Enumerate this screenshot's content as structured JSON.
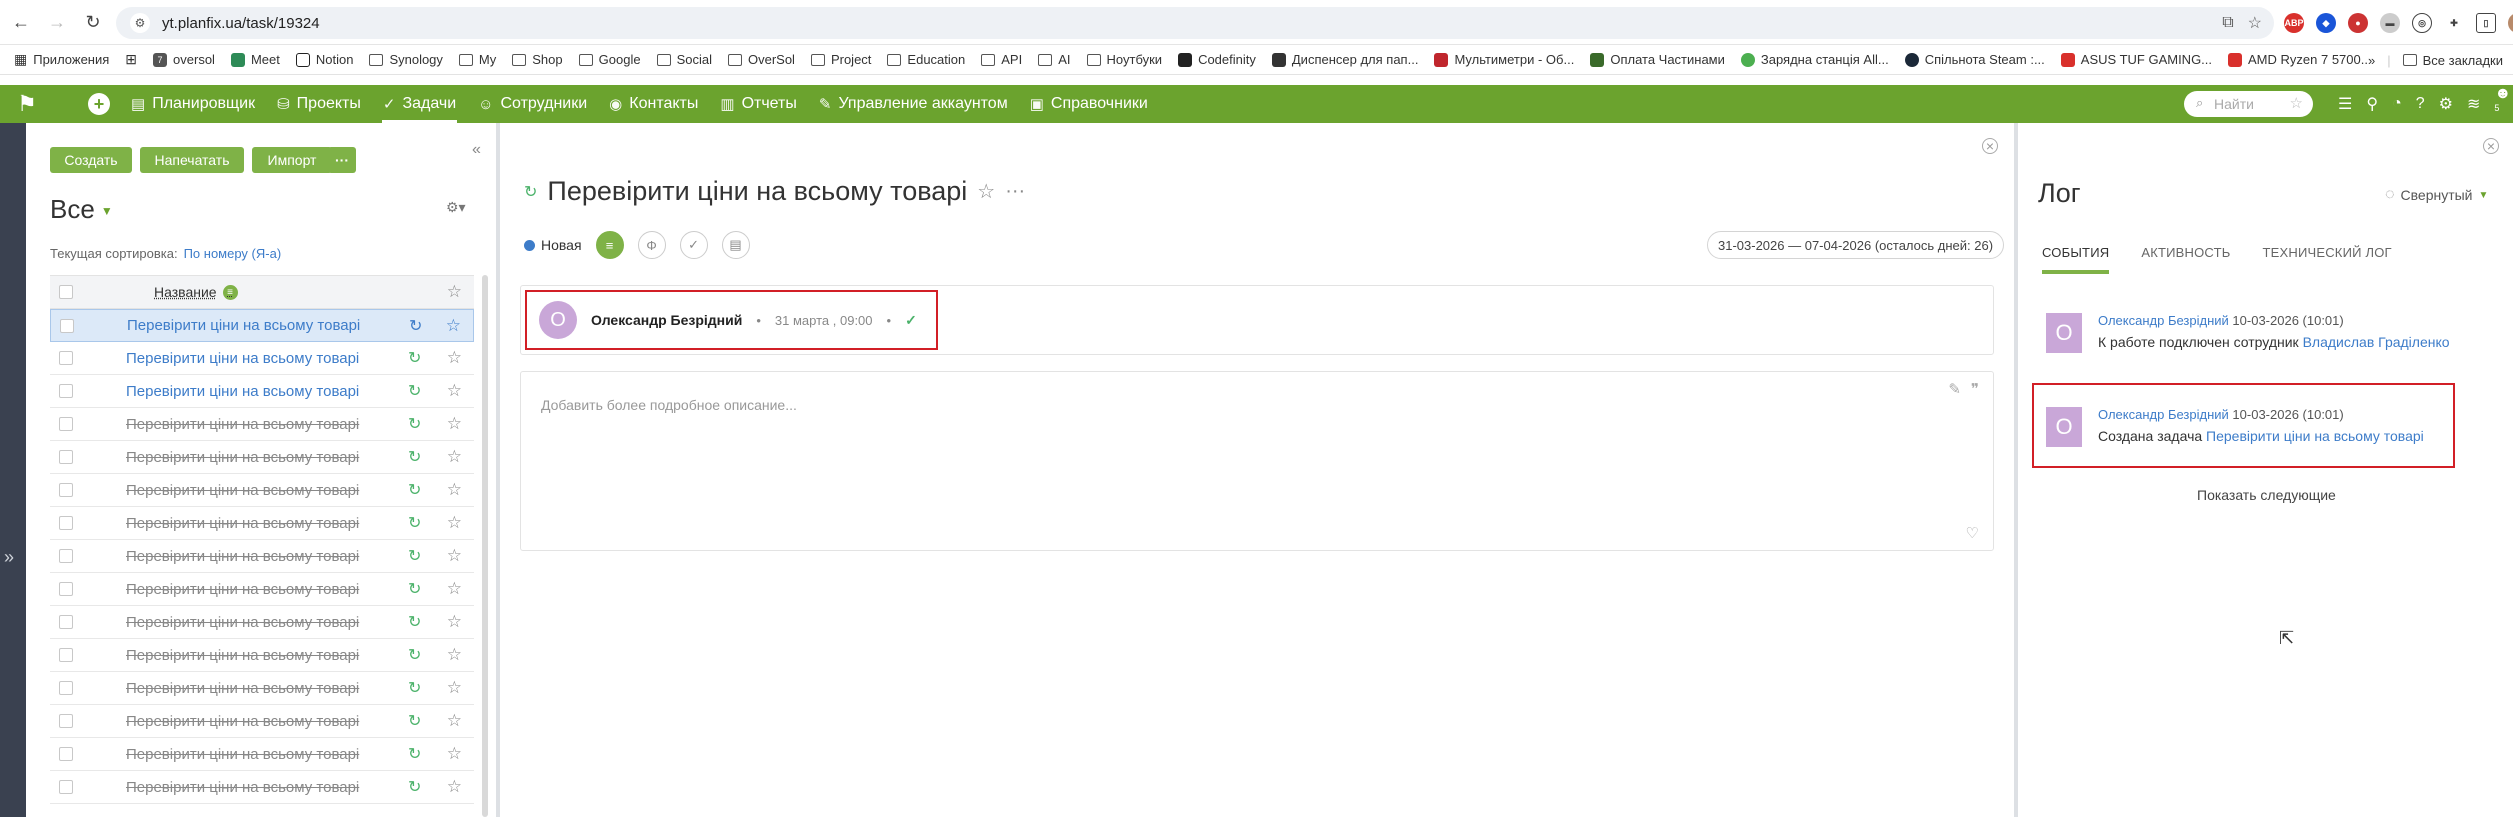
{
  "browser": {
    "url": "yt.planfix.ua/task/19324",
    "bookmarks": [
      {
        "label": "Приложения",
        "icon": "apps-grid-icon"
      },
      {
        "label": "",
        "icon": "grid-icon"
      },
      {
        "label": "oversol",
        "icon": "oversol-favicon"
      },
      {
        "label": "Meet",
        "icon": "meet-favicon"
      },
      {
        "label": "Notion",
        "icon": "notion-favicon"
      },
      {
        "label": "Synology",
        "icon": "folder-icon"
      },
      {
        "label": "My",
        "icon": "folder-icon"
      },
      {
        "label": "Shop",
        "icon": "folder-icon"
      },
      {
        "label": "Google",
        "icon": "folder-icon"
      },
      {
        "label": "Social",
        "icon": "folder-icon"
      },
      {
        "label": "OverSol",
        "icon": "folder-icon"
      },
      {
        "label": "Project",
        "icon": "folder-icon"
      },
      {
        "label": "Education",
        "icon": "folder-icon"
      },
      {
        "label": "API",
        "icon": "folder-icon"
      },
      {
        "label": "AI",
        "icon": "folder-icon"
      },
      {
        "label": "Ноутбуки",
        "icon": "folder-icon"
      },
      {
        "label": "Codefinity",
        "icon": "codefinity-favicon"
      },
      {
        "label": "Диспенсер для пап...",
        "icon": "page-favicon"
      },
      {
        "label": "Мультиметри - Об...",
        "icon": "shop-favicon"
      },
      {
        "label": "Оплата Частинами",
        "icon": "pay-favicon"
      },
      {
        "label": "Зарядна станція All...",
        "icon": "station-favicon"
      },
      {
        "label": "Спільнота Steam :...",
        "icon": "steam-favicon"
      },
      {
        "label": "ASUS TUF GAMING...",
        "icon": "asus-favicon"
      },
      {
        "label": "AMD Ryzen 7 5700...",
        "icon": "amd-favicon"
      }
    ],
    "all_bookmarks": "Все закладки"
  },
  "header": {
    "nav": [
      {
        "label": "Планировщик",
        "icon": "planner-icon"
      },
      {
        "label": "Проекты",
        "icon": "projects-icon"
      },
      {
        "label": "Задачи",
        "icon": "tasks-icon",
        "active": true
      },
      {
        "label": "Сотрудники",
        "icon": "employees-icon"
      },
      {
        "label": "Контакты",
        "icon": "contacts-icon"
      },
      {
        "label": "Отчеты",
        "icon": "reports-icon"
      },
      {
        "label": "Управление аккаунтом",
        "icon": "account-icon"
      },
      {
        "label": "Справочники",
        "icon": "directories-icon"
      }
    ],
    "search_placeholder": "Найти",
    "notification_count": "5"
  },
  "list": {
    "buttons": {
      "create": "Создать",
      "print": "Напечатать",
      "import": "Импорт"
    },
    "title": "Все",
    "sort_label": "Текущая сортировка:",
    "sort_value": "По номеру (Я-а)",
    "column_name": "Название",
    "column_badge": "≡",
    "rows": [
      {
        "name": "Перевірити ціни на всьому товарі",
        "done": false,
        "selected": true
      },
      {
        "name": "Перевірити ціни на всьому товарі",
        "done": false,
        "selected": false
      },
      {
        "name": "Перевірити ціни на всьому товарі",
        "done": false,
        "selected": false
      },
      {
        "name": "Перевірити ціни на всьому товарі",
        "done": true,
        "selected": false
      },
      {
        "name": "Перевірити ціни на всьому товарі",
        "done": true,
        "selected": false
      },
      {
        "name": "Перевірити ціни на всьому товарі",
        "done": true,
        "selected": false
      },
      {
        "name": "Перевірити ціни на всьому товарі",
        "done": true,
        "selected": false
      },
      {
        "name": "Перевірити ціни на всьому товарі",
        "done": true,
        "selected": false
      },
      {
        "name": "Перевірити ціни на всьому товарі",
        "done": true,
        "selected": false
      },
      {
        "name": "Перевірити ціни на всьому товарі",
        "done": true,
        "selected": false
      },
      {
        "name": "Перевірити ціни на всьому товарі",
        "done": true,
        "selected": false
      },
      {
        "name": "Перевірити ціни на всьому товарі",
        "done": true,
        "selected": false
      },
      {
        "name": "Перевірити ціни на всьому товарі",
        "done": true,
        "selected": false
      },
      {
        "name": "Перевірити ціни на всьому товарі",
        "done": true,
        "selected": false
      },
      {
        "name": "Перевірити ціни на всьому товарі",
        "done": true,
        "selected": false
      }
    ]
  },
  "task": {
    "title": "Перевірити ціни на всьому товарі",
    "status": "Новая",
    "status_color": "#3d7cc9",
    "date_range": "31-03-2026 — 07-04-2026  (осталось дней: 26)",
    "author": "Олександр Безрідний",
    "author_initial": "О",
    "created_at": "31 марта , 09:00",
    "description_placeholder": "Добавить более подробное описание..."
  },
  "log": {
    "title": "Лог",
    "view_mode": "Свернутый",
    "tabs": [
      "СОБЫТИЯ",
      "АКТИВНОСТЬ",
      "ТЕХНИЧЕСКИЙ ЛОГ"
    ],
    "events": [
      {
        "initial": "О",
        "who": "Олександр Безрідний",
        "when": "10-03-2026 (10:01)",
        "text": "К работе подключен сотрудник",
        "link": "Владислав Граділенко"
      },
      {
        "initial": "О",
        "who": "Олександр Безрідний",
        "when": "10-03-2026 (10:01)",
        "text": "Создана задача",
        "link": "Перевірити ціни на всьому товарі"
      }
    ],
    "show_more": "Показать следующие"
  },
  "colors": {
    "brand_green": "#6ba32e",
    "button_green": "#7fb247",
    "link_blue": "#3d7cc9",
    "highlight_red": "#d21f26"
  }
}
